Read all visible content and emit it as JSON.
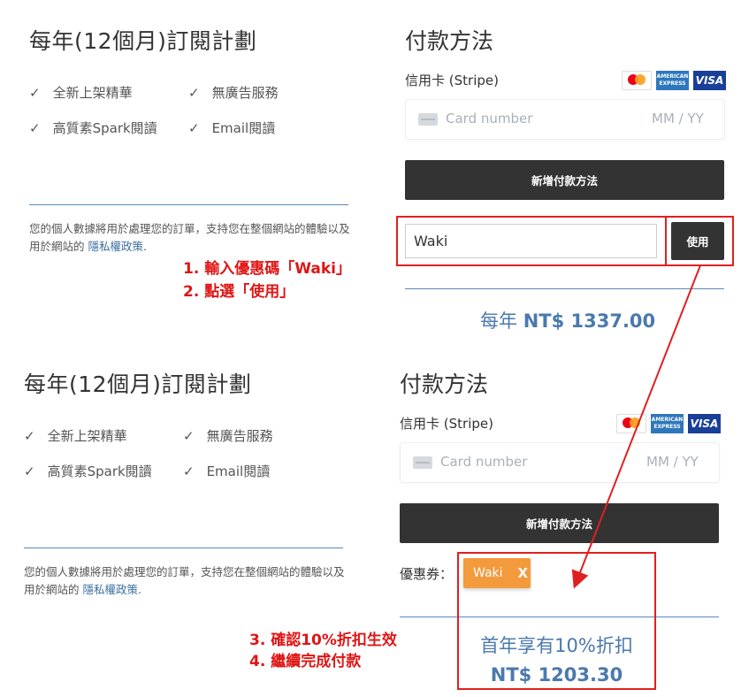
{
  "plan": {
    "title": "每年(12個月)訂閱計劃",
    "features": [
      "全新上架精華",
      "無廣告服務",
      "高質素Spark閱讀",
      "Email閱讀"
    ],
    "privacy_text": "您的個人數據將用於處理您的訂單，支持您在整個網站的體驗以及用於網站的",
    "privacy_link": "隱私權政策",
    "privacy_end": "."
  },
  "payment": {
    "title": "付款方法",
    "stripe_label": "信用卡 (Stripe)",
    "card_placeholder": "Card number",
    "expiry_placeholder": "MM / YY",
    "add_button": "新增付款方法",
    "card_brands": [
      "mastercard-logo",
      "amex-logo",
      "visa-logo"
    ],
    "amex_text_1": "AMERICAN",
    "amex_text_2": "EXPRESS",
    "visa_text": "VISA"
  },
  "coupon": {
    "input_value": "Waki",
    "apply_button": "使用",
    "label": "優惠券：",
    "tag_text": "Waki",
    "tag_remove": "X"
  },
  "price_before": {
    "prefix": "每年",
    "amount": "NT$ 1337.00"
  },
  "price_after": {
    "line1": "首年享有10%折扣",
    "line2": "NT$ 1203.30"
  },
  "annotations": {
    "step1": "1.   輸入優惠碼「Waki」",
    "step2": "2.   點選「使用」",
    "step3": "3.   確認10%折扣生效",
    "step4": "4.   繼續完成付款"
  },
  "colors": {
    "accent": "#4a79ad",
    "annotation_red": "#e02020",
    "button_dark": "#333333",
    "coupon_tag": "#f39a3d"
  }
}
